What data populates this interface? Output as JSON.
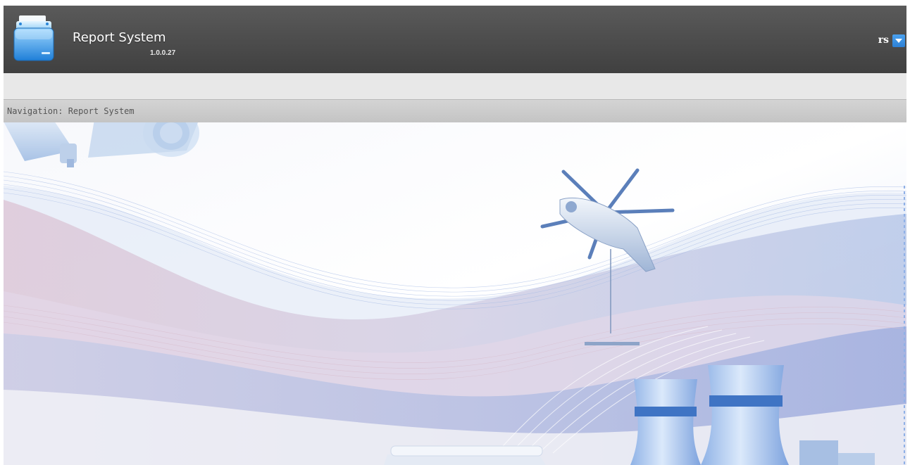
{
  "header": {
    "app_title": "Report System",
    "app_version": "1.0.0.27",
    "logo_icon": "folder-drawer-icon",
    "bg_color": "#4a4a4a"
  },
  "user_menu": {
    "username": "rs",
    "dropdown_icon": "chevron-down-icon",
    "accent_color": "#3b8fe6"
  },
  "navigation": {
    "prefix": "Navigation:",
    "current": "Report System",
    "text": "Navigation: Report System"
  },
  "banner": {
    "illustration": "industry-banner-illustration",
    "elements": [
      "security-camera-icon",
      "helicopter-icon",
      "cooling-tower-icon",
      "train-icon"
    ]
  }
}
